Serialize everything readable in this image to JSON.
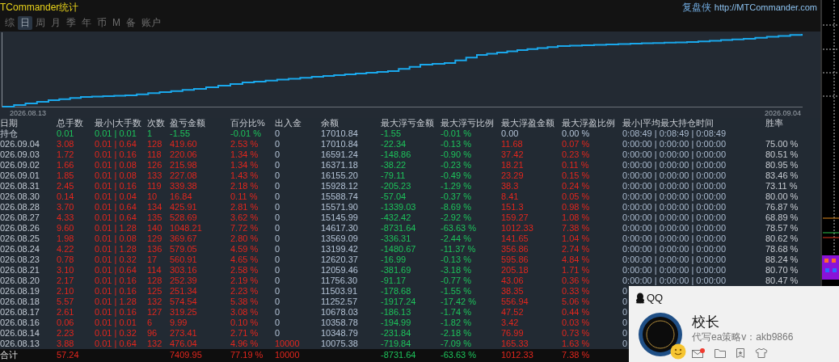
{
  "window": {
    "title": "TCommander统计",
    "brand": "复盘侠",
    "link": "http://MTCommander.com"
  },
  "tabs": [
    {
      "label": "综",
      "selected": false
    },
    {
      "label": "日",
      "selected": true
    },
    {
      "label": "周",
      "selected": false
    },
    {
      "label": "月",
      "selected": false
    },
    {
      "label": "季",
      "selected": false
    },
    {
      "label": "年",
      "selected": false
    },
    {
      "label": "币",
      "selected": false
    },
    {
      "label": "M",
      "selected": false
    },
    {
      "label": "备",
      "selected": false
    },
    {
      "label": "账户",
      "selected": false
    }
  ],
  "chart": {
    "start_label": "2026.08.13",
    "end_label": "2026.09.04"
  },
  "table": {
    "columns": [
      {
        "label": "日期",
        "kind": "date"
      },
      {
        "label": "总手数",
        "kind": "pnl"
      },
      {
        "label": "最小|大手数",
        "kind": "pnl"
      },
      {
        "label": "次数",
        "kind": "pnl"
      },
      {
        "label": "盈亏金额",
        "kind": "pnl"
      },
      {
        "label": "百分比%",
        "kind": "pnl"
      },
      {
        "label": "出入金",
        "kind": "inout"
      },
      {
        "label": "余额",
        "kind": "balance"
      },
      {
        "label": "最大浮亏金额",
        "kind": "loss"
      },
      {
        "label": "最大浮亏比例",
        "kind": "loss"
      },
      {
        "label": "最大浮盈金额",
        "kind": "gain"
      },
      {
        "label": "最大浮盈比例",
        "kind": "gain"
      },
      {
        "label": "最小|平均最大持仓时间",
        "kind": "time"
      },
      {
        "label": "胜率",
        "kind": "rate"
      }
    ],
    "rows": [
      {
        "kind": "open",
        "profit": false,
        "deposit": false,
        "floating_gain": false,
        "cells": [
          "持仓",
          "0.01",
          "0.01 | 0.01",
          "1",
          "-1.55",
          "-0.01 %",
          "0",
          "17010.84",
          "-1.55",
          "-0.01 %",
          "0.00",
          "0.00 %",
          "0:08:49 | 0:08:49 | 0:08:49",
          null
        ]
      },
      {
        "kind": "day",
        "profit": true,
        "deposit": false,
        "floating_gain": true,
        "cells": [
          "026.09.04",
          "3.08",
          "0.01 | 0.64",
          "128",
          "419.60",
          "2.53 %",
          "0",
          "17010.84",
          "-22.34",
          "-0.13 %",
          "11.68",
          "0.07 %",
          "0:00:00 | 0:00:00 | 0:00:00",
          "75.00 %"
        ]
      },
      {
        "kind": "day",
        "profit": true,
        "deposit": false,
        "floating_gain": true,
        "cells": [
          "026.09.03",
          "1.72",
          "0.01 | 0.16",
          "118",
          "220.06",
          "1.34 %",
          "0",
          "16591.24",
          "-148.86",
          "-0.90 %",
          "37.42",
          "0.23 %",
          "0:00:00 | 0:00:00 | 0:00:00",
          "80.51 %"
        ]
      },
      {
        "kind": "day",
        "profit": true,
        "deposit": false,
        "floating_gain": true,
        "cells": [
          "026.09.02",
          "1.66",
          "0.01 | 0.08",
          "126",
          "215.98",
          "1.34 %",
          "0",
          "16371.18",
          "-38.22",
          "-0.23 %",
          "18.21",
          "0.11 %",
          "0:00:00 | 0:00:00 | 0:00:00",
          "80.95 %"
        ]
      },
      {
        "kind": "day",
        "profit": true,
        "deposit": false,
        "floating_gain": true,
        "cells": [
          "026.09.01",
          "1.85",
          "0.01 | 0.08",
          "133",
          "227.08",
          "1.43 %",
          "0",
          "16155.20",
          "-79.11",
          "-0.49 %",
          "23.29",
          "0.15 %",
          "0:00:00 | 0:00:00 | 0:00:00",
          "83.46 %"
        ]
      },
      {
        "kind": "day",
        "profit": true,
        "deposit": false,
        "floating_gain": true,
        "cells": [
          "026.08.31",
          "2.45",
          "0.01 | 0.16",
          "119",
          "339.38",
          "2.18 %",
          "0",
          "15928.12",
          "-205.23",
          "-1.29 %",
          "38.3",
          "0.24 %",
          "0:00:00 | 0:00:00 | 0:00:00",
          "73.11 %"
        ]
      },
      {
        "kind": "day",
        "profit": true,
        "deposit": false,
        "floating_gain": true,
        "cells": [
          "026.08.30",
          "0.14",
          "0.01 | 0.04",
          "10",
          "16.84",
          "0.11 %",
          "0",
          "15588.74",
          "-57.04",
          "-0.37 %",
          "8.41",
          "0.05 %",
          "0:00:00 | 0:00:00 | 0:00:00",
          "80.00 %"
        ]
      },
      {
        "kind": "day",
        "profit": true,
        "deposit": false,
        "floating_gain": true,
        "cells": [
          "026.08.28",
          "3.70",
          "0.01 | 0.64",
          "134",
          "425.91",
          "2.81 %",
          "0",
          "15571.90",
          "-1339.03",
          "-8.69 %",
          "151.3",
          "0.98 %",
          "0:00:00 | 0:00:00 | 0:00:00",
          "76.87 %"
        ]
      },
      {
        "kind": "day",
        "profit": true,
        "deposit": false,
        "floating_gain": true,
        "cells": [
          "026.08.27",
          "4.33",
          "0.01 | 0.64",
          "135",
          "528.69",
          "3.62 %",
          "0",
          "15145.99",
          "-432.42",
          "-2.92 %",
          "159.27",
          "1.08 %",
          "0:00:00 | 0:00:00 | 0:00:00",
          "68.89 %"
        ]
      },
      {
        "kind": "day",
        "profit": true,
        "deposit": false,
        "floating_gain": true,
        "cells": [
          "026.08.26",
          "9.60",
          "0.01 | 1.28",
          "140",
          "1048.21",
          "7.72 %",
          "0",
          "14617.30",
          "-8731.64",
          "-63.63 %",
          "1012.33",
          "7.38 %",
          "0:00:00 | 0:00:00 | 0:00:00",
          "78.57 %"
        ]
      },
      {
        "kind": "day",
        "profit": true,
        "deposit": false,
        "floating_gain": true,
        "cells": [
          "026.08.25",
          "1.98",
          "0.01 | 0.08",
          "129",
          "369.67",
          "2.80 %",
          "0",
          "13569.09",
          "-336.31",
          "-2.44 %",
          "141.65",
          "1.04 %",
          "0:00:00 | 0:00:00 | 0:00:00",
          "80.62 %"
        ]
      },
      {
        "kind": "day",
        "profit": true,
        "deposit": false,
        "floating_gain": true,
        "cells": [
          "026.08.24",
          "4.22",
          "0.01 | 1.28",
          "136",
          "579.05",
          "4.59 %",
          "0",
          "13199.42",
          "-1480.67",
          "-11.37 %",
          "356.86",
          "2.74 %",
          "0:00:00 | 0:00:00 | 0:00:00",
          "78.68 %"
        ]
      },
      {
        "kind": "day",
        "profit": true,
        "deposit": false,
        "floating_gain": true,
        "cells": [
          "026.08.23",
          "0.78",
          "0.01 | 0.32",
          "17",
          "560.91",
          "4.65 %",
          "0",
          "12620.37",
          "-16.99",
          "-0.13 %",
          "595.86",
          "4.84 %",
          "0:00:00 | 0:00:00 | 0:00:00",
          "88.24 %"
        ]
      },
      {
        "kind": "day",
        "profit": true,
        "deposit": false,
        "floating_gain": true,
        "cells": [
          "026.08.21",
          "3.10",
          "0.01 | 0.64",
          "114",
          "303.16",
          "2.58 %",
          "0",
          "12059.46",
          "-381.69",
          "-3.18 %",
          "205.18",
          "1.71 %",
          "0:00:00 | 0:00:00 | 0:00:00",
          "80.70 %"
        ]
      },
      {
        "kind": "day",
        "profit": true,
        "deposit": false,
        "floating_gain": true,
        "cells": [
          "026.08.20",
          "2.17",
          "0.01 | 0.16",
          "128",
          "252.39",
          "2.19 %",
          "0",
          "11756.30",
          "-91.17",
          "-0.77 %",
          "43.06",
          "0.36 %",
          "0:00:00 | 0:00:00 | 0:00:00",
          "80.47 %"
        ]
      },
      {
        "kind": "day",
        "profit": true,
        "deposit": false,
        "floating_gain": true,
        "cells": [
          "026.08.19",
          "2.10",
          "0.01 | 0.16",
          "125",
          "251.34",
          "2.23 %",
          "0",
          "11503.91",
          "-178.68",
          "-1.55 %",
          "38.35",
          "0.33 %",
          "0",
          null
        ]
      },
      {
        "kind": "day",
        "profit": true,
        "deposit": false,
        "floating_gain": true,
        "cells": [
          "026.08.18",
          "5.57",
          "0.01 | 1.28",
          "132",
          "574.54",
          "5.38 %",
          "0",
          "11252.57",
          "-1917.24",
          "-17.42 %",
          "556.94",
          "5.06 %",
          "0",
          null
        ]
      },
      {
        "kind": "day",
        "profit": true,
        "deposit": false,
        "floating_gain": true,
        "cells": [
          "026.08.17",
          "2.61",
          "0.01 | 0.16",
          "127",
          "319.25",
          "3.08 %",
          "0",
          "10678.03",
          "-186.13",
          "-1.74 %",
          "47.52",
          "0.44 %",
          "0",
          null
        ]
      },
      {
        "kind": "day",
        "profit": true,
        "deposit": false,
        "floating_gain": true,
        "cells": [
          "026.08.16",
          "0.06",
          "0.01 | 0.01",
          "6",
          "9.99",
          "0.10 %",
          "0",
          "10358.78",
          "-194.99",
          "-1.82 %",
          "3.42",
          "0.03 %",
          "0",
          null
        ]
      },
      {
        "kind": "day",
        "profit": true,
        "deposit": false,
        "floating_gain": true,
        "cells": [
          "026.08.14",
          "2.23",
          "0.01 | 0.32",
          "96",
          "273.41",
          "2.71 %",
          "0",
          "10348.79",
          "-231.84",
          "-2.18 %",
          "76.99",
          "0.73 %",
          "0",
          null
        ]
      },
      {
        "kind": "day",
        "profit": true,
        "deposit": true,
        "floating_gain": true,
        "cells": [
          "026.08.13",
          "3.88",
          "0.01 | 0.64",
          "132",
          "476.04",
          "4.96 %",
          "10000",
          "10075.38",
          "-719.84",
          "-7.09 %",
          "165.33",
          "1.63 %",
          "0",
          null
        ]
      },
      {
        "kind": "total",
        "profit": true,
        "deposit": true,
        "floating_gain": true,
        "cells": [
          "合计",
          "57.24",
          null,
          null,
          "7409.95",
          "77.19 %",
          "10000",
          null,
          "-8731.64",
          "-63.63 %",
          "1012.33",
          "7.38 %",
          null,
          null
        ]
      }
    ]
  },
  "qq_popup": {
    "app": "QQ",
    "name": "校长",
    "signature": "代写ea策略v：akb9866",
    "unread": true
  }
}
